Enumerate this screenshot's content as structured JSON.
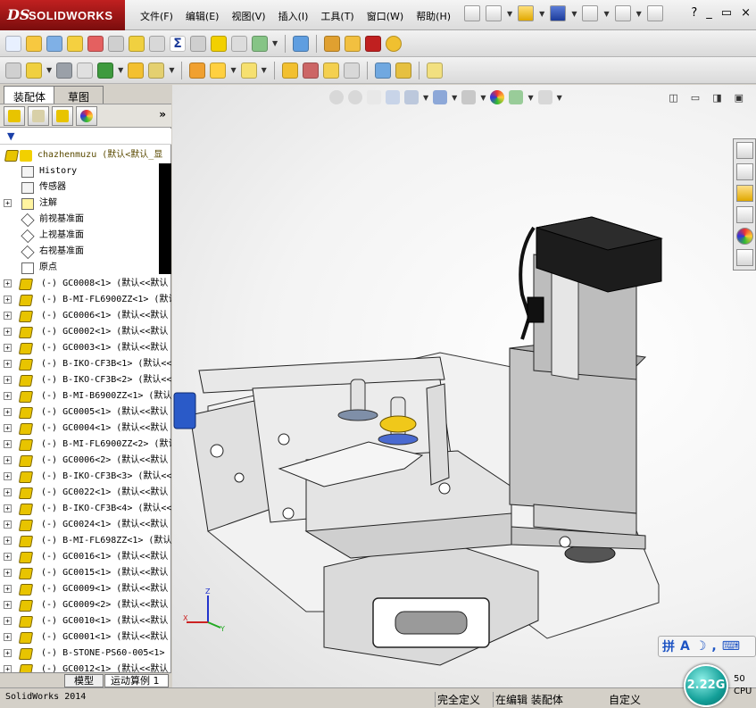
{
  "app": {
    "brand_ds": "DS",
    "brand_name": "SOLIDWORKS",
    "menu": [
      "文件(F)",
      "编辑(E)",
      "视图(V)",
      "插入(I)",
      "工具(T)",
      "窗口(W)",
      "帮助(H)"
    ],
    "window_controls": [
      "_",
      "▭",
      "×"
    ],
    "help_label": "?"
  },
  "feature_manager": {
    "tabs": {
      "assembly": "装配体",
      "sketch": "草图"
    },
    "more_label": "»",
    "filter_label": "▼",
    "root": "chazhenmuzu  (默认<默认_显",
    "items": [
      {
        "label": "History",
        "kind": "history",
        "expand": false
      },
      {
        "label": "传感器",
        "kind": "sensor",
        "expand": false
      },
      {
        "label": "注解",
        "kind": "annotation",
        "expand": true
      },
      {
        "label": "前视基准面",
        "kind": "plane",
        "expand": false
      },
      {
        "label": "上视基准面",
        "kind": "plane",
        "expand": false
      },
      {
        "label": "右视基准面",
        "kind": "plane",
        "expand": false
      },
      {
        "label": "原点",
        "kind": "origin",
        "expand": false
      }
    ],
    "parts": [
      "(-) GC0008<1> (默认<<默认",
      "(-) B-MI-FL6900ZZ<1> (默认",
      "(-) GC0006<1> (默认<<默认",
      "(-) GC0002<1> (默认<<默认",
      "(-) GC0003<1> (默认<<默认",
      "(-) B-IKO-CF3B<1> (默认<<",
      "(-) B-IKO-CF3B<2> (默认<<",
      "(-) B-MI-B6900ZZ<1> (默认",
      "(-) GC0005<1> (默认<<默认",
      "(-) GC0004<1> (默认<<默认",
      "(-) B-MI-FL6900ZZ<2> (默认",
      "(-) GC0006<2> (默认<<默认",
      "(-) B-IKO-CF3B<3> (默认<<",
      "(-) GC0022<1> (默认<<默认",
      "(-) B-IKO-CF3B<4> (默认<<",
      "(-) GC0024<1> (默认<<默认",
      "(-) B-MI-FL698ZZ<1> (默认",
      "(-) GC0016<1> (默认<<默认",
      "(-) GC0015<1> (默认<<默认",
      "(-) GC0009<1> (默认<<默认",
      "(-) GC0009<2> (默认<<默认",
      "(-) GC0010<1> (默认<<默认",
      "(-) GC0001<1> (默认<<默认",
      "(-) B-STONE-PS60-005<1>",
      "(-) GC0012<1> (默认<<默认"
    ]
  },
  "bottom_tabs": {
    "model": "模型",
    "motion": "运动算例 1"
  },
  "status": {
    "app_version": "SolidWorks 2014",
    "definition": "完全定义",
    "editing": "在编辑 装配体",
    "custom": "自定义",
    "cpu_value": "2.22G",
    "cpu_line1": "50",
    "cpu_line2": "CPU"
  },
  "ime": {
    "label": "拼",
    "a": "A"
  },
  "triad": {
    "x": "X",
    "y": "Y",
    "z": "Z"
  },
  "colors": {
    "brand": "#b01c1c",
    "part_icon": "#e8c400",
    "cpu_widget": "#139f98"
  }
}
